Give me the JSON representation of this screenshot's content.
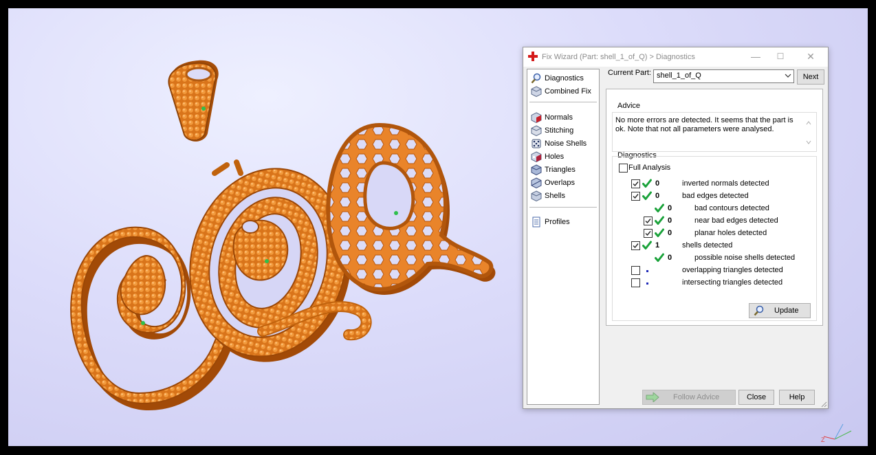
{
  "window": {
    "title": "Fix Wizard (Part: shell_1_of_Q) > Diagnostics",
    "minimize": "—",
    "maximize": "☐",
    "close": "✕"
  },
  "nav": {
    "items": [
      {
        "label": "Diagnostics",
        "icon": "magnifier-icon"
      },
      {
        "label": "Combined Fix",
        "icon": "cube-icon"
      },
      {
        "label": "Normals",
        "icon": "normals-cube-icon"
      },
      {
        "label": "Stitching",
        "icon": "stitching-cube-icon"
      },
      {
        "label": "Noise Shells",
        "icon": "dice-icon"
      },
      {
        "label": "Holes",
        "icon": "holes-cube-icon"
      },
      {
        "label": "Triangles",
        "icon": "triangles-cube-icon"
      },
      {
        "label": "Overlaps",
        "icon": "overlaps-cube-icon"
      },
      {
        "label": "Shells",
        "icon": "shells-cube-icon"
      },
      {
        "label": "Profiles",
        "icon": "document-icon"
      }
    ]
  },
  "header": {
    "current_part_label": "Current Part:",
    "current_part_value": "shell_1_of_Q",
    "next_label": "Next"
  },
  "advice": {
    "title": "Advice",
    "text": "No more errors are detected. It seems that the part is ok. Note that not all parameters were analysed."
  },
  "diagnostics": {
    "title": "Diagnostics",
    "full_analysis_label": "Full Analysis",
    "full_analysis_checked": false,
    "rows": [
      {
        "checkbox": true,
        "checked": true,
        "status": "check",
        "count": "0",
        "label": "inverted normals detected",
        "indent": 0
      },
      {
        "checkbox": true,
        "checked": true,
        "status": "check",
        "count": "0",
        "label": "bad edges detected",
        "indent": 0
      },
      {
        "checkbox": false,
        "checked": false,
        "status": "check",
        "count": "0",
        "label": "bad contours detected",
        "indent": 1
      },
      {
        "checkbox": true,
        "checked": true,
        "status": "check",
        "count": "0",
        "label": "near bad edges detected",
        "indent": 1
      },
      {
        "checkbox": true,
        "checked": true,
        "status": "check",
        "count": "0",
        "label": "planar holes detected",
        "indent": 1
      },
      {
        "checkbox": true,
        "checked": true,
        "status": "check",
        "count": "1",
        "label": "shells detected",
        "indent": 0
      },
      {
        "checkbox": false,
        "checked": false,
        "status": "check",
        "count": "0",
        "label": "possible noise shells detected",
        "indent": 1
      },
      {
        "checkbox": true,
        "checked": false,
        "status": "dot",
        "count": "",
        "label": "overlapping triangles detected",
        "indent": 0
      },
      {
        "checkbox": true,
        "checked": false,
        "status": "dot",
        "count": "",
        "label": "intersecting triangles detected",
        "indent": 0
      }
    ],
    "update_label": "Update"
  },
  "footer": {
    "follow_advice_label": "Follow Advice",
    "close_label": "Close",
    "help_label": "Help"
  },
  "colors": {
    "model": "#e07a18",
    "model_dark": "#a84f08",
    "check_green": "#1aa23a",
    "viewport_bg": "#d8d8f6"
  }
}
